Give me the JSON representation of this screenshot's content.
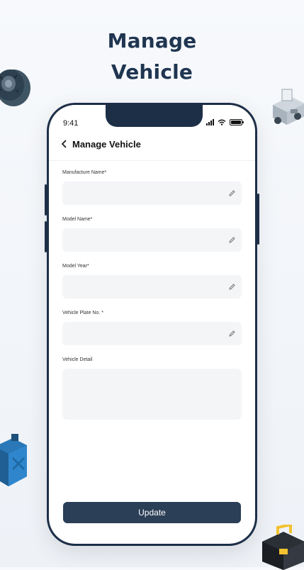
{
  "hero": {
    "line1": "Manage",
    "line2": "Vehicle"
  },
  "status_bar": {
    "time": "9:41"
  },
  "header": {
    "title": "Manage Vehicle"
  },
  "form": {
    "fields": [
      {
        "label": "Manufacture Name*",
        "value": ""
      },
      {
        "label": "Model Name*",
        "value": ""
      },
      {
        "label": "Model Year*",
        "value": ""
      },
      {
        "label": "Vehicle Plate No. *",
        "value": ""
      },
      {
        "label": "Vehicle Detail",
        "value": ""
      }
    ]
  },
  "actions": {
    "update_label": "Update"
  },
  "colors": {
    "primary": "#2b3f57",
    "phone_frame": "#1d2f47",
    "hero_text": "#1f3550",
    "field_bg": "#f4f5f7"
  }
}
